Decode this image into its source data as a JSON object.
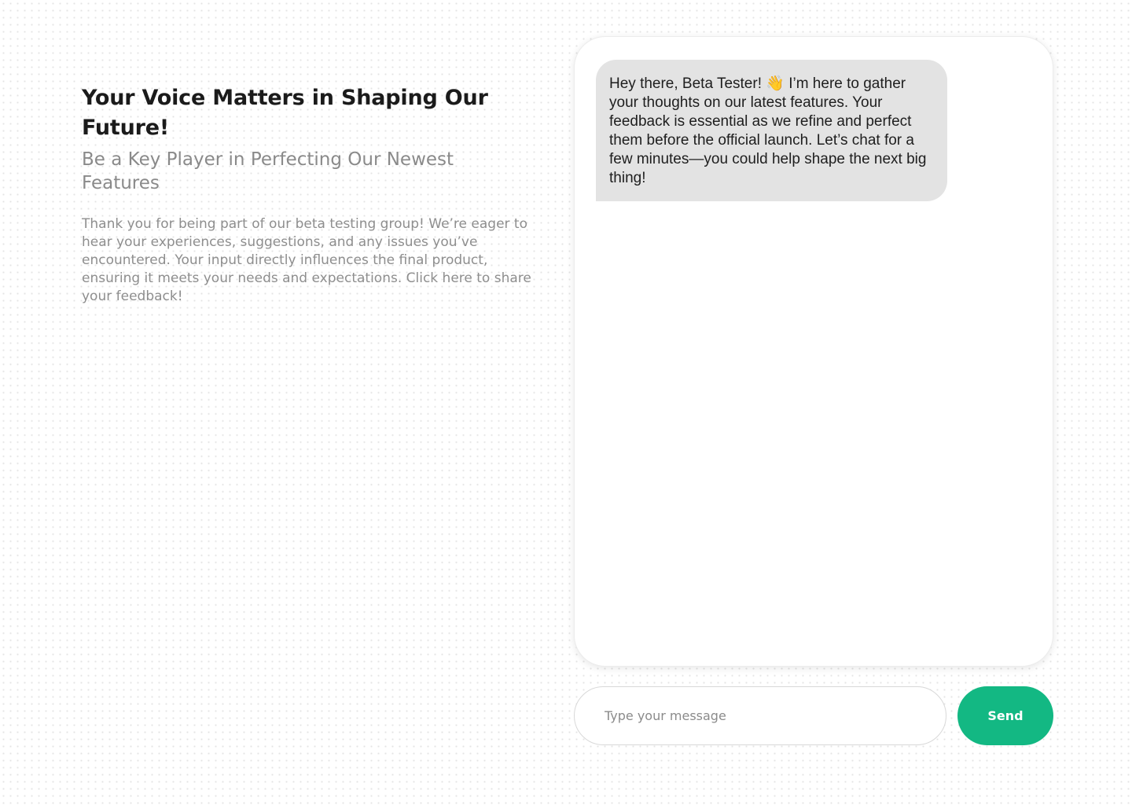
{
  "intro": {
    "title": "Your Voice Matters in Shaping Our Future!",
    "subtitle": "Be a Key Player in Perfecting Our Newest Features",
    "body": "Thank you for being part of our beta testing group! We’re eager to hear your experiences, suggestions, and any issues you’ve encountered. Your input directly influences the final product, ensuring it meets your needs and expectations. Click here to share your feedback!"
  },
  "chat": {
    "messages": [
      {
        "sender": "bot",
        "text_before_emoji": "Hey there, Beta Tester! ",
        "emoji": "👋",
        "text_after_emoji": " I’m here to gather your thoughts on our latest features. Your feedback is essential as we refine and perfect them before the official launch. Let’s chat for a few minutes—you could help shape the next big thing!"
      }
    ]
  },
  "composer": {
    "input_value": "",
    "placeholder": "Type your message",
    "send_label": "Send"
  },
  "colors": {
    "accent": "#13b883",
    "bubble": "#e3e3e3",
    "muted_text": "#8e8e8e"
  }
}
